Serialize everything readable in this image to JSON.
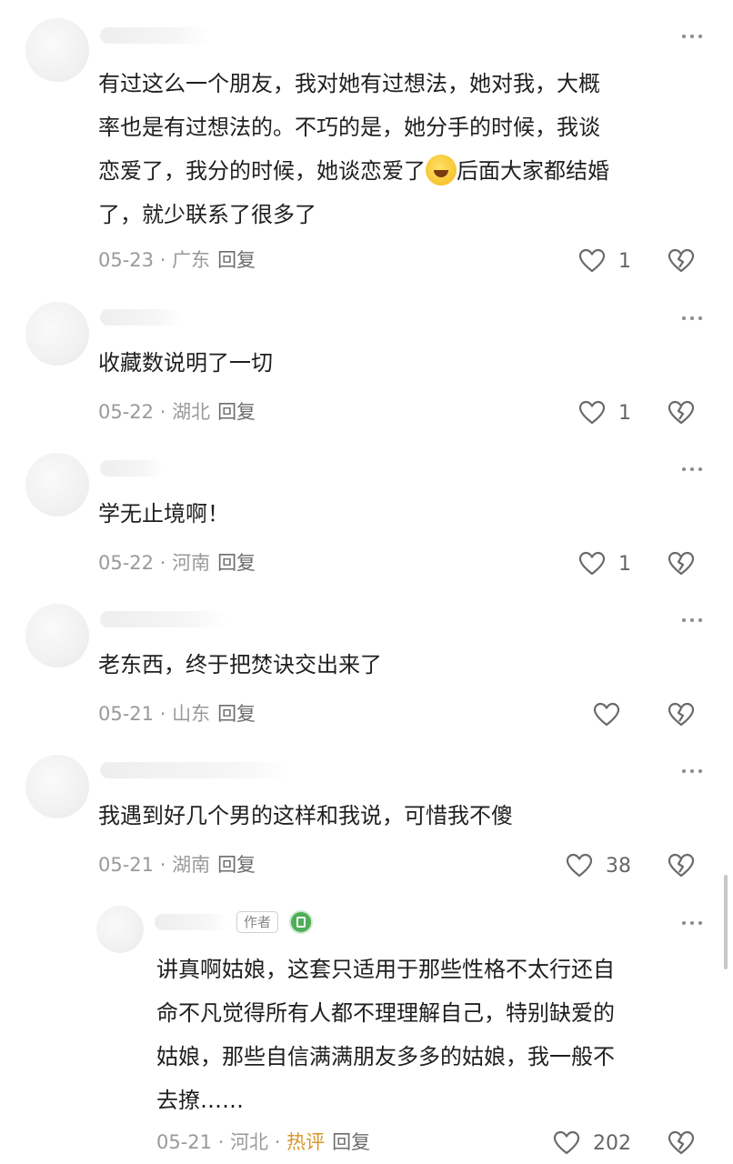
{
  "comments": [
    {
      "text_parts": [
        "有过这么一个朋友，我对她有过想法，她对我，大概\n率也是有过想法的。不巧的是，她分手的时候，我谈\n恋爱了，我分的时候，她谈恋爱了",
        "后面大家都结婚\n了，就少联系了很多了"
      ],
      "emoji": "rofl-emoji",
      "date": "05-23",
      "region": "广东",
      "reply": "回复",
      "likes": "1"
    },
    {
      "text": "收藏数说明了一切",
      "date": "05-22",
      "region": "湖北",
      "reply": "回复",
      "likes": "1"
    },
    {
      "text": "学无止境啊！",
      "date": "05-22",
      "region": "河南",
      "reply": "回复",
      "likes": "1"
    },
    {
      "text": "老东西，终于把焚诀交出来了",
      "date": "05-21",
      "region": "山东",
      "reply": "回复",
      "likes": ""
    },
    {
      "text": "我遇到好几个男的这样和我说，可惜我不傻",
      "date": "05-21",
      "region": "湖南",
      "reply": "回复",
      "likes": "38"
    }
  ],
  "reply_comment": {
    "author_badge": "作者",
    "text": "讲真啊姑娘，这套只适用于那些性格不太行还自\n命不凡觉得所有人都不理理解自己，特别缺爱的\n姑娘，那些自信满满朋友多多的姑娘，我一般不\n去撩……",
    "date": "05-21",
    "region": "河北",
    "hot_tag": "热评",
    "reply": "回复",
    "likes": "202"
  },
  "separator": " · ",
  "icons": {
    "like": "heart-outline-icon",
    "dislike": "broken-heart-icon",
    "more": "more-dots-icon"
  },
  "colors": {
    "text": "#1f1f1f",
    "meta": "#9a9a9a",
    "hot": "#d8962a",
    "level_badge": "#4fae5a"
  }
}
